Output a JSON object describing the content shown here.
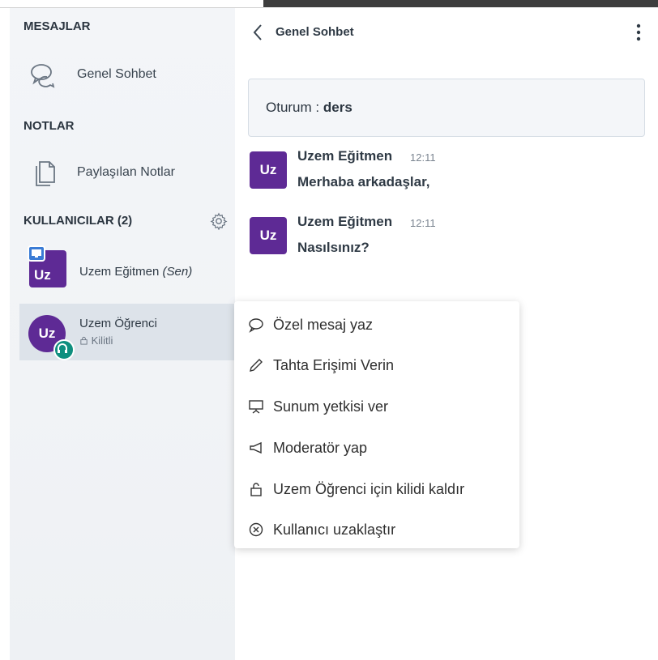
{
  "sidebar": {
    "messages_title": "MESAJLAR",
    "chat_item": "Genel Sohbet",
    "notes_title": "NOTLAR",
    "notes_item": "Paylaşılan Notlar",
    "users_title": "KULLANICILAR (2)",
    "users": [
      {
        "initials": "Uz",
        "name": "Uzem Eğitmen",
        "suffix": "(Sen)"
      },
      {
        "initials": "Uz",
        "name": "Uzem Öğrenci",
        "status": "Kilitli"
      }
    ]
  },
  "chat": {
    "title": "Genel Sohbet",
    "session_label": "Oturum :",
    "session_name": "ders",
    "messages": [
      {
        "initials": "Uz",
        "sender": "Uzem Eğitmen",
        "time": "12:11",
        "text": "Merhaba arkadaşlar,"
      },
      {
        "initials": "Uz",
        "sender": "Uzem Eğitmen",
        "time": "12:11",
        "text": "Nasılsınız?"
      }
    ]
  },
  "context_menu": {
    "items": [
      {
        "label": "Özel mesaj yaz",
        "icon": "chat-bubble-icon"
      },
      {
        "label": "Tahta Erişimi Verin",
        "icon": "pencil-icon"
      },
      {
        "label": "Sunum yetkisi ver",
        "icon": "presentation-icon"
      },
      {
        "label": "Moderatör yap",
        "icon": "megaphone-icon"
      },
      {
        "label": "Uzem Öğrenci için kilidi kaldır",
        "icon": "unlock-icon"
      },
      {
        "label": "Kullanıcı uzaklaştır",
        "icon": "remove-circle-icon"
      }
    ]
  },
  "colors": {
    "avatar": "#5e2a95",
    "presenter_badge": "#3a7bd5",
    "listen_badge": "#0f8f7f"
  }
}
